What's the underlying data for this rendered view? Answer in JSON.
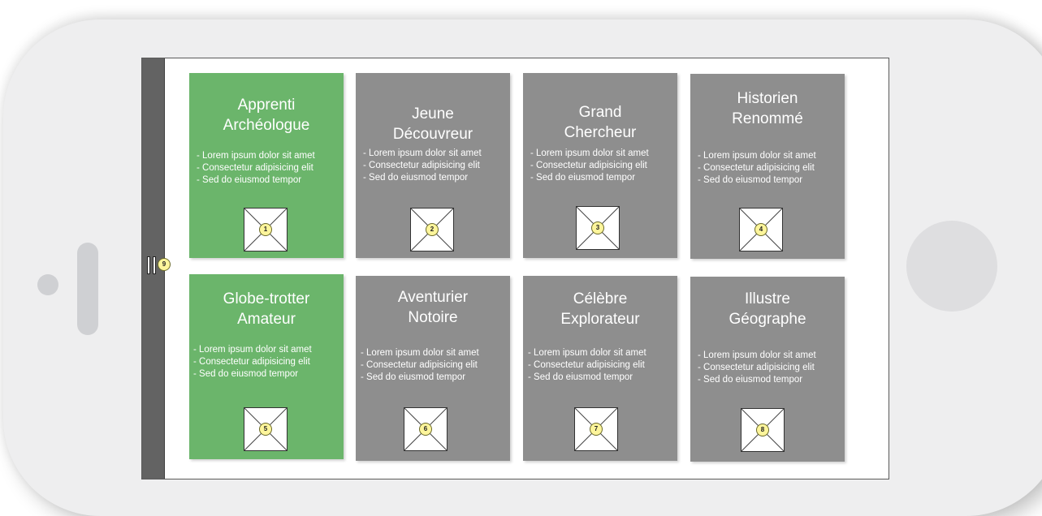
{
  "screen": {
    "rail_marker": "9"
  },
  "cards": [
    {
      "title_line1": "Apprenti",
      "title_line2": "Archéologue",
      "items": [
        "- Lorem ipsum dolor sit amet",
        "- Consectetur adipisicing elit",
        "- Sed do eiusmod tempor"
      ],
      "marker": "1",
      "state": "unlocked"
    },
    {
      "title_line1": "Jeune",
      "title_line2": "Découvreur",
      "items": [
        "- Lorem ipsum dolor sit amet",
        "- Consectetur adipisicing elit",
        "- Sed do eiusmod tempor"
      ],
      "marker": "2",
      "state": "locked"
    },
    {
      "title_line1": "Grand",
      "title_line2": "Chercheur",
      "items": [
        "- Lorem ipsum dolor sit amet",
        "- Consectetur adipisicing elit",
        "- Sed do eiusmod tempor"
      ],
      "marker": "3",
      "state": "locked"
    },
    {
      "title_line1": "Historien",
      "title_line2": "Renommé",
      "items": [
        "- Lorem ipsum dolor sit amet",
        "- Consectetur adipisicing elit",
        "- Sed do eiusmod tempor"
      ],
      "marker": "4",
      "state": "locked"
    },
    {
      "title_line1": "Globe-trotter",
      "title_line2": "Amateur",
      "items": [
        "- Lorem ipsum dolor sit amet",
        "- Consectetur adipisicing elit",
        "- Sed do eiusmod tempor"
      ],
      "marker": "5",
      "state": "unlocked"
    },
    {
      "title_line1": "Aventurier",
      "title_line2": "Notoire",
      "items": [
        "- Lorem ipsum dolor sit amet",
        "- Consectetur adipisicing elit",
        "- Sed do eiusmod tempor"
      ],
      "marker": "6",
      "state": "locked"
    },
    {
      "title_line1": "Célèbre",
      "title_line2": "Explorateur",
      "items": [
        "- Lorem ipsum dolor sit amet",
        "- Consectetur adipisicing elit",
        "- Sed do eiusmod tempor"
      ],
      "marker": "7",
      "state": "locked"
    },
    {
      "title_line1": "Illustre",
      "title_line2": "Géographe",
      "items": [
        "- Lorem ipsum dolor sit amet",
        "- Consectetur adipisicing elit",
        "- Sed do eiusmod tempor"
      ],
      "marker": "8",
      "state": "locked"
    }
  ],
  "colors": {
    "unlocked": "#6bb56b",
    "locked": "#8e8e8e",
    "marker": "#fdf59b",
    "rail": "#636363"
  },
  "icons": {
    "image_placeholder": "image-placeholder-icon",
    "drag_handle": "drag-handle-icon"
  }
}
